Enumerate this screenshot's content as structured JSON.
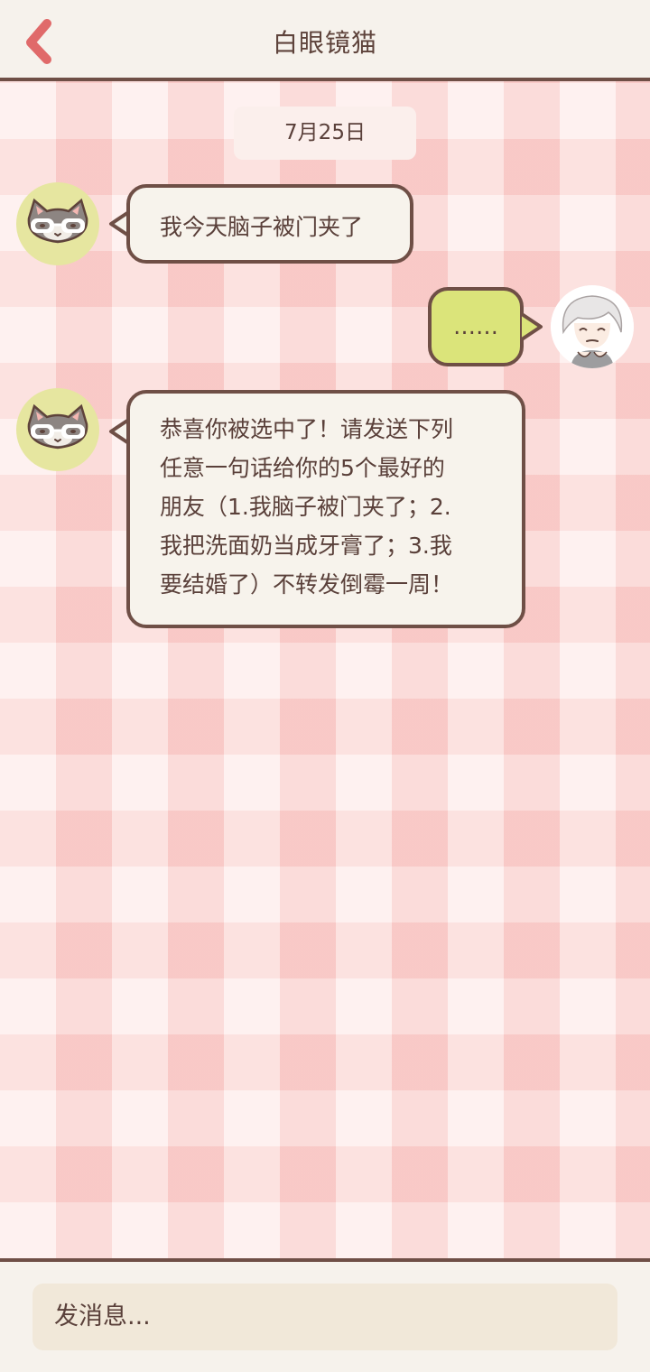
{
  "header": {
    "title": "白眼镜猫",
    "back_icon": "chevron-left-icon",
    "accent_color": "#e06a6a"
  },
  "chat": {
    "date": "7月25日",
    "background_pattern": "pink-gingham",
    "messages": [
      {
        "sender": "contact",
        "text": "我今天脑子被门夹了"
      },
      {
        "sender": "me",
        "text": "……"
      },
      {
        "sender": "contact",
        "lines": [
          "恭喜你被选中了！请发送下列",
          "任意一句话给你的5个最好的",
          "朋友（1.我脑子被门夹了；2.",
          "我把洗面奶当成牙膏了；3.我",
          "要结婚了）不转发倒霉一周！"
        ]
      }
    ]
  },
  "composer": {
    "placeholder": "发消息..."
  },
  "colors": {
    "border": "#6f4f46",
    "incoming_bubble": "#f7f3ec",
    "outgoing_bubble": "#dbe47a",
    "text": "#5a403a"
  }
}
